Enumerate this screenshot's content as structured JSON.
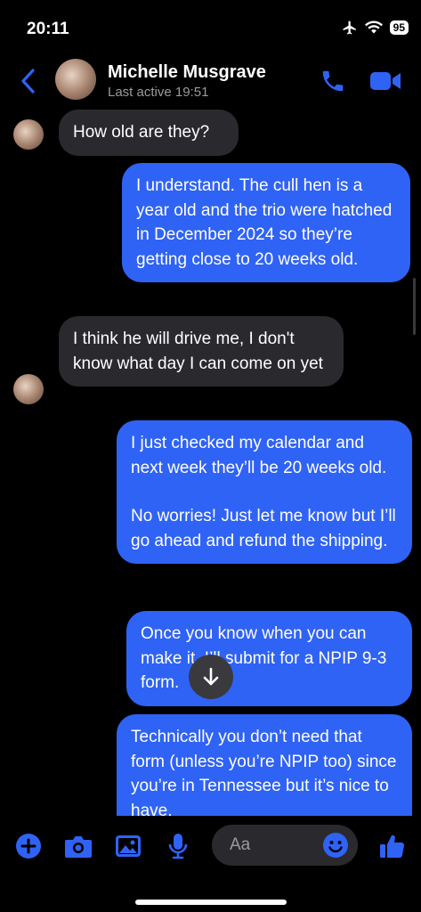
{
  "status": {
    "time": "20:11",
    "battery": "95"
  },
  "header": {
    "contact_name": "Michelle Musgrave",
    "last_active": "Last active 19:51"
  },
  "messages": [
    {
      "direction": "incoming",
      "paragraphs": [
        "How old are they?"
      ]
    },
    {
      "direction": "outgoing",
      "paragraphs": [
        "I understand. The cull hen is a year old and the trio were hatched in December 2024 so they’re getting close to 20 weeks old."
      ]
    },
    {
      "direction": "incoming",
      "paragraphs": [
        "I think he will drive me, I don't know what day I can come on yet"
      ]
    },
    {
      "direction": "outgoing",
      "paragraphs": [
        "I just checked my calendar and next week they’ll be 20 weeks old.",
        "No worries! Just let me know but I’ll go ahead and refund the shipping."
      ]
    },
    {
      "direction": "outgoing",
      "paragraphs": [
        "Once you know when you can make it, I’ll submit for a NPIP 9-3 form."
      ]
    },
    {
      "direction": "outgoing",
      "paragraphs": [
        "Technically you don’t need that form (unless you’re NPIP too) since you’re in Tennessee but it’s nice to have."
      ]
    }
  ],
  "composer": {
    "placeholder": "Aa"
  },
  "colors": {
    "accent": "#2f63f6",
    "incoming_bubble": "#2a2a2e",
    "background": "#000000"
  },
  "icons": {
    "header": [
      "back-chevron-icon",
      "phone-icon",
      "video-camera-icon"
    ],
    "composer": [
      "plus-icon",
      "camera-icon",
      "image-icon",
      "microphone-icon",
      "emoji-icon",
      "thumbs-up-icon"
    ],
    "status": [
      "airplane-icon",
      "wifi-icon"
    ],
    "floating": [
      "arrow-down-icon"
    ]
  }
}
